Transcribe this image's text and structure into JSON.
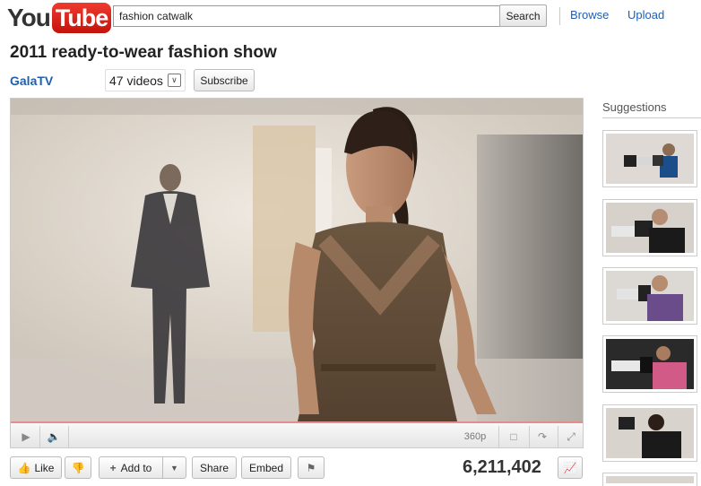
{
  "header": {
    "logo_you": "You",
    "logo_tube": "Tube",
    "search_value": "fashion catwalk",
    "search_button": "Search",
    "browse_link": "Browse",
    "upload_link": "Upload"
  },
  "video": {
    "title": "2011 ready-to-wear fashion show",
    "channel": "GalaTV",
    "video_count": "47 videos",
    "subscribe_label": "Subscribe",
    "quality": "360p",
    "view_count": "6,211,402"
  },
  "actions": {
    "like_label": "Like",
    "add_to_label": "Add to",
    "share_label": "Share",
    "embed_label": "Embed"
  },
  "sidebar": {
    "title": "Suggestions",
    "thumbnails": [
      "photographer-thumbnail-1",
      "photographer-thumbnail-2",
      "photographer-thumbnail-3",
      "photographer-thumbnail-4",
      "photographer-thumbnail-5",
      "photographer-thumbnail-6"
    ]
  },
  "colors": {
    "link": "#1e5fb3",
    "logo_red": "#d8201a",
    "progress": "#e58c8c"
  }
}
